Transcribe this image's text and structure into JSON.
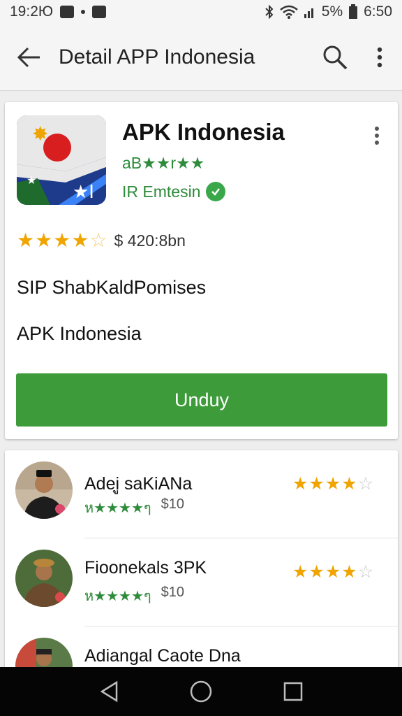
{
  "status_bar": {
    "time_left": "19:2Ю",
    "battery": "5%",
    "time_right": "6:50"
  },
  "app_bar": {
    "title": "Detail APP Indonesia",
    "icons": [
      "back-arrow-icon",
      "search-icon",
      "more-vert-icon"
    ]
  },
  "app": {
    "name": "APK Indonesia",
    "subtitle1": "aB★★r★★",
    "subtitle2": "IR Emtesin",
    "rating_stars": 4.5,
    "rating_meta": "$ 420:8bn",
    "description_line1": "SIP ShabKaldPomises",
    "description_line2": "APK Indonesia",
    "download_label": "Unduy"
  },
  "list": [
    {
      "name": "Adeiู saKiANa",
      "meta_stars": "ห★★★★ๆ",
      "price": "$10",
      "rating": 4
    },
    {
      "name": "Fioonekals 3PK",
      "meta_stars": "ห★★★★ๆ",
      "price": "$10",
      "rating": 4
    },
    {
      "name": "Adiangal Caote Dna",
      "meta_stars": "",
      "price": "",
      "rating": 0
    }
  ],
  "colors": {
    "accent_green": "#3d9b3a",
    "star_orange": "#f0a400",
    "nav_bar": "#050505"
  }
}
